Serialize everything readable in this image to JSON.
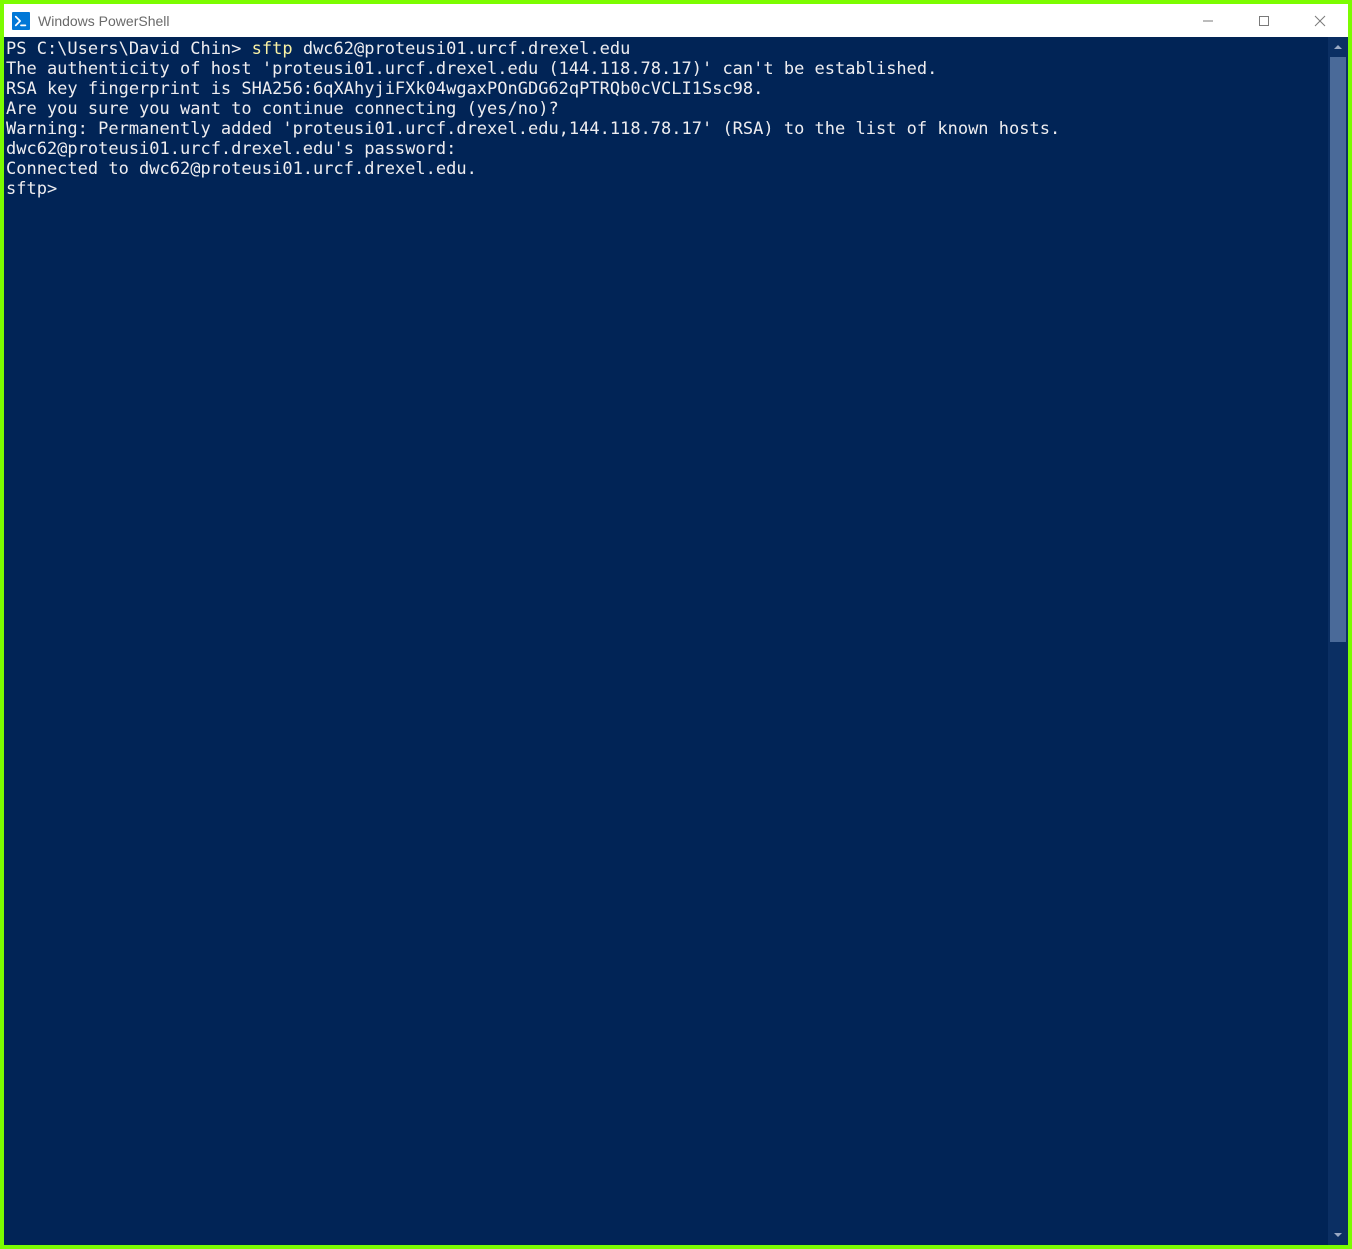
{
  "window": {
    "title": "Windows PowerShell"
  },
  "terminal": {
    "prompt_ps": "PS C:\\Users\\David Chin> ",
    "cmd_name": "sftp",
    "cmd_args": " dwc62@proteusi01.urcf.drexel.edu",
    "lines": [
      "The authenticity of host 'proteusi01.urcf.drexel.edu (144.118.78.17)' can't be established.",
      "RSA key fingerprint is SHA256:6qXAhyjiFXk04wgaxPOnGDG62qPTRQb0cVCLI1Ssc98.",
      "Are you sure you want to continue connecting (yes/no)?",
      "Warning: Permanently added 'proteusi01.urcf.drexel.edu,144.118.78.17' (RSA) to the list of known hosts.",
      "dwc62@proteusi01.urcf.drexel.edu's password:",
      "Connected to dwc62@proteusi01.urcf.drexel.edu."
    ],
    "sftp_prompt": "sftp>"
  },
  "colors": {
    "terminal_bg": "#012456",
    "terminal_fg": "#eeedf0",
    "cmd_highlight": "#f9f1a5",
    "border": "#7cfc00"
  }
}
